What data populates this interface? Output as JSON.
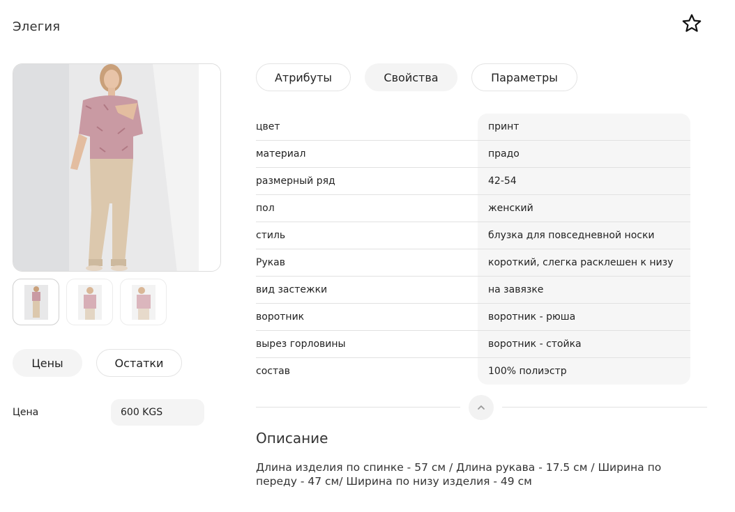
{
  "product": {
    "title": "Элегия"
  },
  "tabs_left": {
    "prices": "Цены",
    "stock": "Остатки"
  },
  "price": {
    "label": "Цена",
    "value": "600 KGS"
  },
  "tabs_right": {
    "attributes": "Атрибуты",
    "properties": "Свойства",
    "parameters": "Параметры"
  },
  "properties": [
    {
      "key": "цвет",
      "value": "принт"
    },
    {
      "key": "материал",
      "value": "прадо"
    },
    {
      "key": "размерный ряд",
      "value": "42-54"
    },
    {
      "key": "пол",
      "value": "женский"
    },
    {
      "key": "стиль",
      "value": "блузка для повседневной носки"
    },
    {
      "key": "Рукав",
      "value": "короткий, слегка расклешен к низу"
    },
    {
      "key": "вид застежки",
      "value": "на завязке"
    },
    {
      "key": "воротник",
      "value": "воротник - рюша"
    },
    {
      "key": "вырез горловины",
      "value": "воротник - стойка"
    },
    {
      "key": "состав",
      "value": "100% полиэстр"
    }
  ],
  "description": {
    "title": "Описание",
    "text": "Длина изделия по спинке - 57 см / Длина рукава - 17.5 см / Ширина по переду - 47 см/ Ширина по низу изделия - 49 см"
  },
  "icons": {
    "favorite": "star-outline-icon",
    "collapse": "chevron-up-icon"
  },
  "colors": {
    "pill_active_bg": "#f4f4f4",
    "border": "#e3e3e3",
    "values_bg": "#f6f6f6"
  }
}
